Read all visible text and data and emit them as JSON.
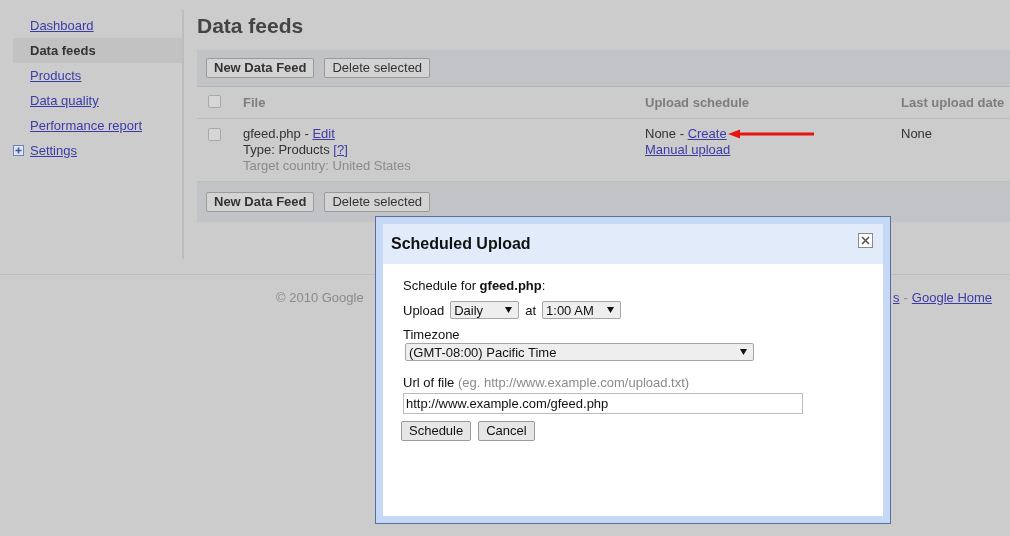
{
  "sidebar": {
    "items": [
      {
        "label": "Dashboard",
        "selected": false,
        "kind": "link"
      },
      {
        "label": "Data feeds",
        "selected": true,
        "kind": "link"
      },
      {
        "label": "Products",
        "selected": false,
        "kind": "link"
      },
      {
        "label": "Data quality",
        "selected": false,
        "kind": "link"
      },
      {
        "label": "Performance report",
        "selected": false,
        "kind": "link"
      },
      {
        "label": "Settings",
        "selected": false,
        "kind": "expandable"
      }
    ]
  },
  "page": {
    "title": "Data feeds"
  },
  "toolbar": {
    "buttons": [
      "New Data Feed",
      "Delete selected"
    ]
  },
  "table": {
    "header_checked": false,
    "columns": [
      "File",
      "Upload schedule",
      "Last upload date"
    ],
    "rows": [
      {
        "checked": false,
        "file_name": "gfeed.php -",
        "edit_link": "Edit",
        "type": "Type: Products",
        "type_help": "[?]",
        "target": "Target country: United States",
        "schedule": "None -",
        "schedule_link": "Create",
        "manual_link": "Manual upload",
        "last_upload": "None"
      }
    ]
  },
  "bottom_toolbar": {
    "buttons": [
      "New Data Feed",
      "Delete selected"
    ]
  },
  "footer": {
    "copyright": "© 2010 Google",
    "link_tail": "s",
    "separator": "-",
    "home_link": "Google Home"
  },
  "dialog": {
    "title": "Scheduled Upload",
    "schedule_for": "Schedule for **gfeed.php**:",
    "upload_label": "Upload",
    "frequency": "Daily",
    "at_label": "at",
    "time": "1:00 AM",
    "timezone_label": "Timezone",
    "timezone": "(GMT-08:00) Pacific Time",
    "url_label": "Url of file",
    "url_hint": "(eg. http://www.example.com/upload.txt)",
    "url_value": "http://www.example.com/gfeed.php",
    "buttons": [
      "Schedule",
      "Cancel"
    ]
  }
}
